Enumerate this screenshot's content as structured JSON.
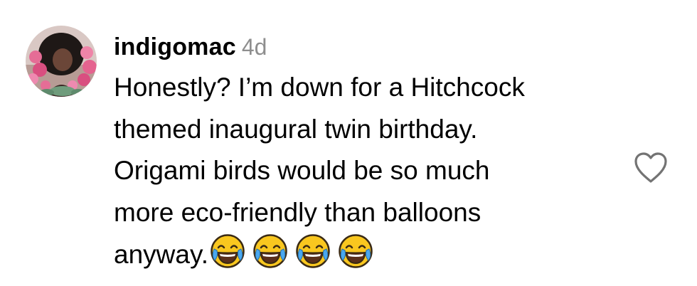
{
  "comment": {
    "username": "indigomac",
    "timestamp": "4d",
    "body_lines": [
      "Honestly? I’m down for a Hitchcock",
      "themed inaugural twin birthday.",
      "Origami birds would be so much",
      "more eco-friendly than balloons",
      "anyway."
    ],
    "trailing_emojis": [
      "😂",
      "😂",
      "😂",
      "😂"
    ],
    "emoji_icon": "face-with-tears-of-joy-icon",
    "like_icon": "heart-outline-icon"
  },
  "colors": {
    "username": "#000000",
    "timestamp": "#8e8e8e",
    "text": "#000000",
    "heart_outline": "#737373",
    "background": "#ffffff"
  }
}
